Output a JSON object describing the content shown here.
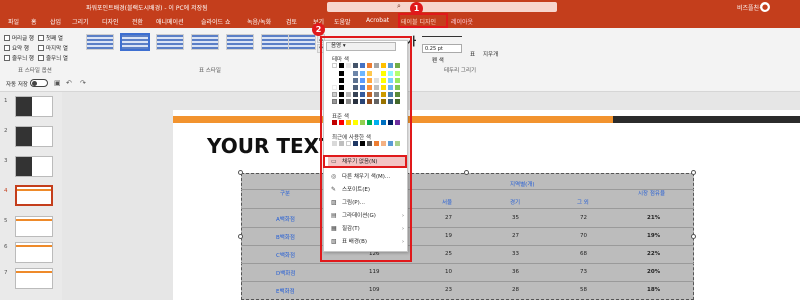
{
  "window": {
    "title": "파워포인트배경(블랙도시배경) - 이 PC에 저장됨",
    "user_name": "비즈플친구5",
    "search_icon": "search-icon",
    "brand_color": "#c43e1c"
  },
  "ribbon_tabs": [
    {
      "label": "파일"
    },
    {
      "label": "홈"
    },
    {
      "label": "삽입"
    },
    {
      "label": "그리기"
    },
    {
      "label": "디자인"
    },
    {
      "label": "전환"
    },
    {
      "label": "애니메이션"
    },
    {
      "label": "슬라이드 쇼"
    },
    {
      "label": "녹음/녹화"
    },
    {
      "label": "검토"
    },
    {
      "label": "보기"
    },
    {
      "label": "도움말"
    },
    {
      "label": "Acrobat"
    },
    {
      "label": "테이블 디자인"
    },
    {
      "label": "레이아웃"
    }
  ],
  "table_style_options": {
    "items": [
      "머리글 행",
      "첫째 열",
      "요약 행",
      "마지막 열",
      "줄무늬 행",
      "줄무늬 열"
    ],
    "group_label": "표 스타일 옵션"
  },
  "table_styles": {
    "group_label": "표 스타일"
  },
  "borders": {
    "shading_label": "음영",
    "pen_weight": "0.25 pt",
    "pen_color_label": "펜 색",
    "table_label": "표",
    "eraser_label": "지우개",
    "draw_group_label": "테두리 그리기",
    "text_sample": "가"
  },
  "quick_access": {
    "autosave_label": "자동 저장",
    "toggle_state": "끔"
  },
  "thumbnails": {
    "numbers": [
      "1",
      "2",
      "3",
      "4",
      "5",
      "6",
      "7"
    ],
    "selected": "4"
  },
  "slide": {
    "title": "YOUR TEXT H",
    "accent_color": "#f2932e"
  },
  "table": {
    "header": {
      "col_label": "구분",
      "group_label": "지역별(개)",
      "cols": [
        "서울",
        "경기",
        "그 외",
        "시장 점유율"
      ]
    },
    "rows": [
      {
        "name": "A백화점",
        "c1": "27",
        "c2": "35",
        "c3": "72",
        "share": "21%"
      },
      {
        "name": "B백화점",
        "c1": "19",
        "c2": "27",
        "c3": "70",
        "share": "19%"
      },
      {
        "name": "C백화점",
        "c0": "126",
        "c1": "25",
        "c2": "33",
        "c3": "68",
        "share": "22%"
      },
      {
        "name": "D백화점",
        "c0": "119",
        "c1": "10",
        "c2": "36",
        "c3": "73",
        "share": "20%"
      },
      {
        "name": "E백화점",
        "c0": "109",
        "c1": "23",
        "c2": "28",
        "c3": "58",
        "share": "18%"
      }
    ]
  },
  "shading_menu": {
    "header": "음영",
    "theme_colors_label": "테마 색",
    "standard_colors_label": "표준 색",
    "recent_colors_label": "최근에 사용한 색",
    "items": [
      {
        "label": "채우기 없음(N)",
        "icon": "no-fill-icon",
        "submenu": false
      },
      {
        "label": "다른 채우기 색(M)...",
        "icon": "palette-icon",
        "submenu": false
      },
      {
        "label": "스포이트(E)",
        "icon": "eyedropper-icon",
        "submenu": false
      },
      {
        "label": "그림(P)...",
        "icon": "picture-icon",
        "submenu": false
      },
      {
        "label": "그라데이션(G)",
        "icon": "gradient-icon",
        "submenu": true
      },
      {
        "label": "질감(T)",
        "icon": "texture-icon",
        "submenu": true
      },
      {
        "label": "표 배경(B)",
        "icon": "table-background-icon",
        "submenu": true
      }
    ],
    "theme_colors": [
      "#ffffff",
      "#000000",
      "#e7e6e6",
      "#44546a",
      "#4472c4",
      "#ed7d31",
      "#a5a5a5",
      "#ffc000",
      "#5b9bd5",
      "#70ad47"
    ],
    "standard_colors": [
      "#c00000",
      "#ff0000",
      "#ffc000",
      "#ffff00",
      "#92d050",
      "#00b050",
      "#00b0f0",
      "#0070c0",
      "#002060",
      "#7030a0"
    ],
    "recent_colors": [
      "#d9d9d9",
      "#bfbfbf",
      "#ffffff",
      "#1f3864",
      "#000000",
      "#595959",
      "#ed7d31",
      "#f4b183",
      "#5b9bd5",
      "#a9d18e"
    ]
  },
  "annotations": {
    "step1": "1",
    "step2": "2",
    "highlight_color": "#e0191b"
  }
}
